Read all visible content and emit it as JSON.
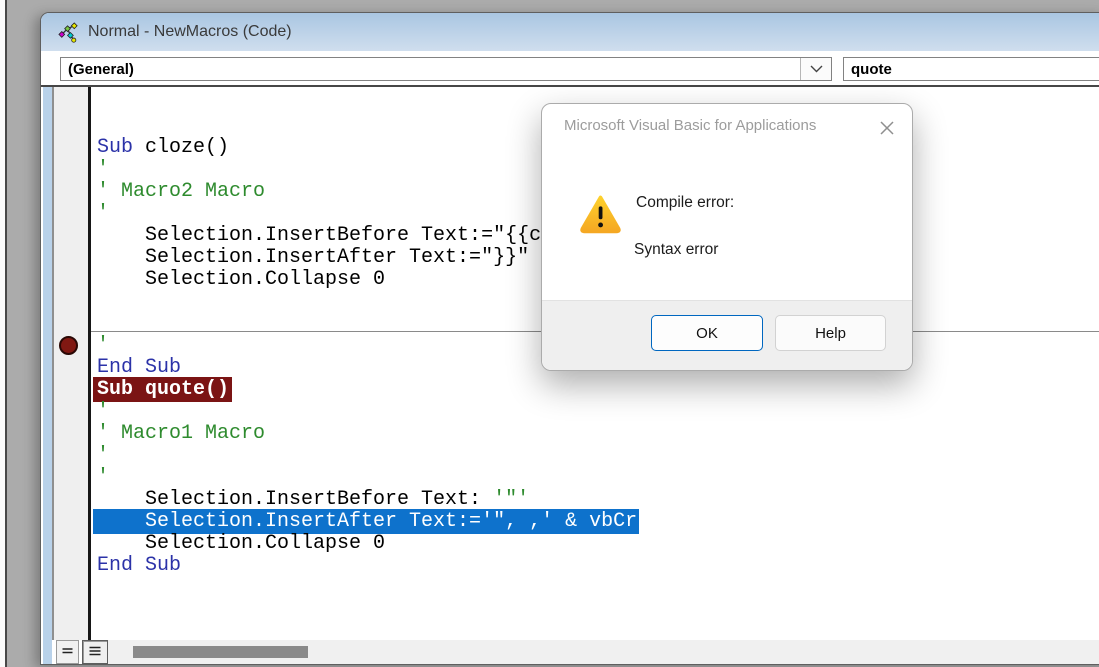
{
  "window": {
    "title": "Normal - NewMacros (Code)"
  },
  "toolbar": {
    "object_dropdown": "(General)",
    "procedure_dropdown": "quote",
    "chevron_icon": "chevron-down"
  },
  "code": {
    "breakpoint_line_index": 11,
    "lines": [
      {
        "segments": [
          {
            "text": "Sub",
            "style": "keyword"
          },
          {
            "text": " cloze()",
            "style": "plain"
          }
        ]
      },
      {
        "segments": [
          {
            "text": "'",
            "style": "comment"
          }
        ]
      },
      {
        "segments": [
          {
            "text": "' Macro2 Macro",
            "style": "comment"
          }
        ]
      },
      {
        "segments": [
          {
            "text": "'",
            "style": "comment"
          }
        ]
      },
      {
        "segments": [
          {
            "text": "    Selection.InsertBefore Text:=\"{{c",
            "style": "plain"
          }
        ]
      },
      {
        "segments": [
          {
            "text": "    Selection.InsertAfter Text:=\"}}\"",
            "style": "plain"
          }
        ]
      },
      {
        "segments": [
          {
            "text": "    Selection.Collapse 0",
            "style": "plain"
          }
        ]
      },
      {
        "segments": []
      },
      {
        "segments": []
      },
      {
        "segments": [
          {
            "text": "'",
            "style": "comment"
          }
        ]
      },
      {
        "segments": [
          {
            "text": "End Sub",
            "style": "keyword"
          }
        ]
      },
      {
        "separator_before": true,
        "segments": [
          {
            "text": "Sub quote()",
            "style": "error"
          }
        ]
      },
      {
        "segments": [
          {
            "text": "'",
            "style": "comment"
          }
        ]
      },
      {
        "segments": [
          {
            "text": "' Macro1 Macro",
            "style": "comment"
          }
        ]
      },
      {
        "segments": [
          {
            "text": "'",
            "style": "comment"
          }
        ]
      },
      {
        "segments": [
          {
            "text": "'",
            "style": "comment"
          }
        ]
      },
      {
        "segments": [
          {
            "text": "    Selection.InsertBefore Text: ",
            "style": "plain"
          },
          {
            "text": "'\"'",
            "style": "comment"
          }
        ]
      },
      {
        "segments": [
          {
            "text": "    Selection.InsertAfter Text:='\", ,' & vbCr",
            "style": "selection"
          }
        ]
      },
      {
        "segments": [
          {
            "text": "    Selection.Collapse 0",
            "style": "plain"
          }
        ]
      },
      {
        "segments": [
          {
            "text": "End Sub",
            "style": "keyword"
          }
        ]
      }
    ]
  },
  "bottom_bar": {
    "procedure_view_icon": "procedure-view",
    "full_module_view_icon": "full-module-view"
  },
  "dialog": {
    "title": "Microsoft Visual Basic for Applications",
    "close_icon": "close-x",
    "warning_icon": "warning-triangle",
    "message_title": "Compile error:",
    "message_detail": "Syntax error",
    "ok_label": "OK",
    "help_label": "Help"
  },
  "colors": {
    "titlebar_top": "#a9c6e2",
    "titlebar_bottom": "#cfdeee",
    "mdi_background": "#ababab",
    "keyword": "#2b32a8",
    "comment": "#2e8b2e",
    "error_highlight": "#7b1414",
    "selection_highlight": "#0e72cc",
    "breakpoint": "#801812",
    "dialog_title_gray": "#9c9c9c",
    "ok_border_blue": "#0067c0",
    "footer_gray": "#efefef",
    "warning_yellow": "#fcc21b",
    "scrollbar_thumb": "#8a8a8a"
  }
}
